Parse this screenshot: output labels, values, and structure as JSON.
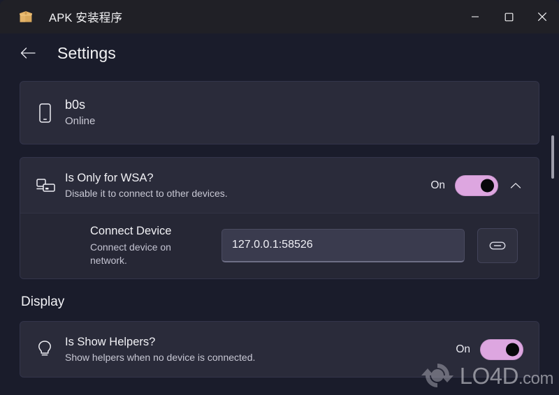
{
  "window": {
    "title": "APK 安装程序",
    "app_icon": "package-icon",
    "controls": [
      {
        "name": "minimize",
        "glyph": "minimize-icon"
      },
      {
        "name": "maximize",
        "glyph": "maximize-icon"
      },
      {
        "name": "close",
        "glyph": "close-icon"
      }
    ]
  },
  "header": {
    "back_icon": "arrow-left-icon",
    "title": "Settings"
  },
  "device_card": {
    "icon": "phone-icon",
    "name": "b0s",
    "status": "Online"
  },
  "wsa_card": {
    "icon": "devices-icon",
    "title": "Is Only for WSA?",
    "subtitle": "Disable it to connect to other devices.",
    "toggle_label": "On",
    "toggle_state": "on",
    "expand_icon": "chevron-up-icon",
    "connect": {
      "title": "Connect Device",
      "description": "Connect device on network.",
      "input_value": "127.0.0.1:58526",
      "input_placeholder": "127.0.0.1:58526",
      "action_icon": "link-icon"
    }
  },
  "display_section": {
    "heading": "Display",
    "helpers_card": {
      "icon": "lightbulb-icon",
      "title": "Is Show Helpers?",
      "subtitle": "Show helpers when no device is connected.",
      "toggle_label": "On",
      "toggle_state": "on"
    }
  },
  "watermark": {
    "text": "LO4D",
    "domain": ".com",
    "logo": "refresh-circle-icon"
  },
  "colors": {
    "accent": "#dda6e0",
    "window_background": "#1a1c2b",
    "titlebar_background": "#202026",
    "card_background": "#2a2b3a",
    "subrow_background": "#262735",
    "text_primary": "#f1f1f5",
    "text_secondary": "#c8c8d4"
  }
}
